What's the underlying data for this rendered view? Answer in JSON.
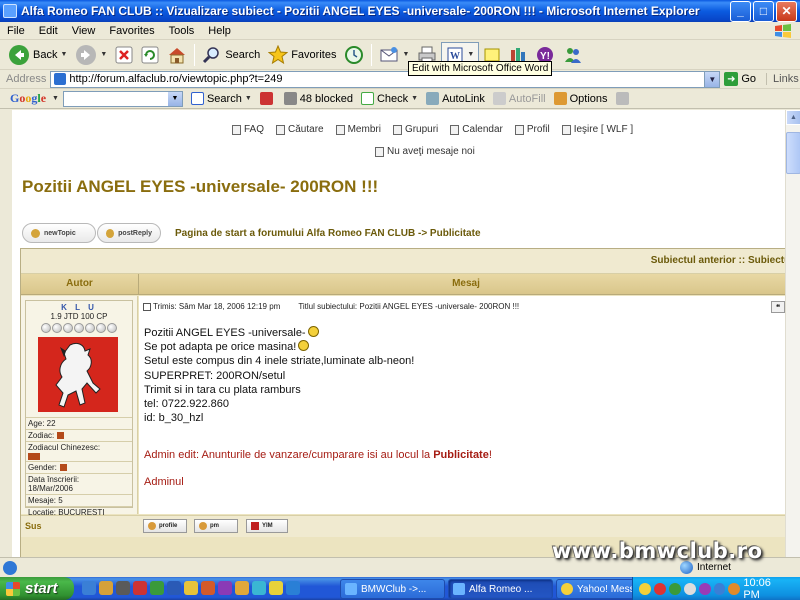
{
  "window": {
    "title": "Alfa Romeo FAN CLUB :: Vizualizare subiect - Pozitii ANGEL EYES -universale- 200RON !!! - Microsoft Internet Explorer",
    "minimize": "_",
    "maximize": "□",
    "close": "✕"
  },
  "menu": [
    "File",
    "Edit",
    "View",
    "Favorites",
    "Tools",
    "Help"
  ],
  "toolbar": {
    "back_label": "Back",
    "search_label": "Search",
    "favorites_label": "Favorites",
    "tooltip": "Edit with Microsoft Office Word"
  },
  "address": {
    "label": "Address",
    "url": "http://forum.alfaclub.ro/viewtopic.php?t=249",
    "go_label": "Go",
    "links_label": "Links"
  },
  "googlebar": {
    "logo": [
      "G",
      "o",
      "o",
      "g",
      "l",
      "e"
    ],
    "search_label": "Search",
    "blocked_label": "48 blocked",
    "check_label": "Check",
    "autolink_label": "AutoLink",
    "autofill_label": "AutoFill",
    "options_label": "Options"
  },
  "forum": {
    "nav": [
      "FAQ",
      "Căutare",
      "Membri",
      "Grupuri",
      "Calendar",
      "Profil",
      "Ieşire [ WLF ]"
    ],
    "messages": "Nu aveţi mesaje noi",
    "topic_title": "Pozitii ANGEL EYES -universale- 200RON !!!",
    "new_topic": "newTopic",
    "post_reply": "postReply",
    "breadcrumb": "Pagina de start a forumului Alfa Romeo FAN CLUB -> Publicitate",
    "prev_next": "Subiectul anterior :: Subiectul",
    "col_author": "Autor",
    "col_message": "Mesaj",
    "post": {
      "username": "K L U",
      "rank": "1.9 JTD 100 CP",
      "age": "Age: 22",
      "zodiac": "Zodiac:",
      "chinese_zodiac": "Zodiacul Chinezesc:",
      "gender": "Gender:",
      "joined_label": "Data înscrierii:",
      "joined": "18/Mar/2006",
      "posts": "Mesaje: 5",
      "location": "Locaţie: BUCURESTI",
      "posted": "Trimis: Sâm Mar 18, 2006 12:19 pm",
      "subject": "Titlul subiectului: Pozitii ANGEL EYES -universale- 200RON !!!",
      "body": [
        "Pozitii ANGEL EYES -universale-",
        "Se pot adapta pe orice masina!",
        "Setul este compus din 4 inele striate,luminate alb-neon!",
        "SUPERPRET: 200RON/setul",
        "Trimit si in tara cu plata ramburs",
        "tel: 0722.922.860",
        "id: b_30_hzl"
      ],
      "admin_note": "Admin edit: Anunturile de vanzare/cumparare isi au locul la ",
      "admin_link": "Publicitate",
      "admin_tail": "!",
      "signature": "Adminul"
    },
    "back_to_top": "Sus",
    "btn_profile": "profile",
    "btn_pm": "pm",
    "btn_yim": "YIM"
  },
  "watermark": "www.bmwclub.ro",
  "status": {
    "zone": "Internet"
  },
  "taskbar": {
    "start": "start",
    "tasks": [
      "BMWClub ->...",
      "Alfa Romeo ...",
      "Yahoo! Mess..."
    ],
    "clock": "10:06 PM"
  }
}
